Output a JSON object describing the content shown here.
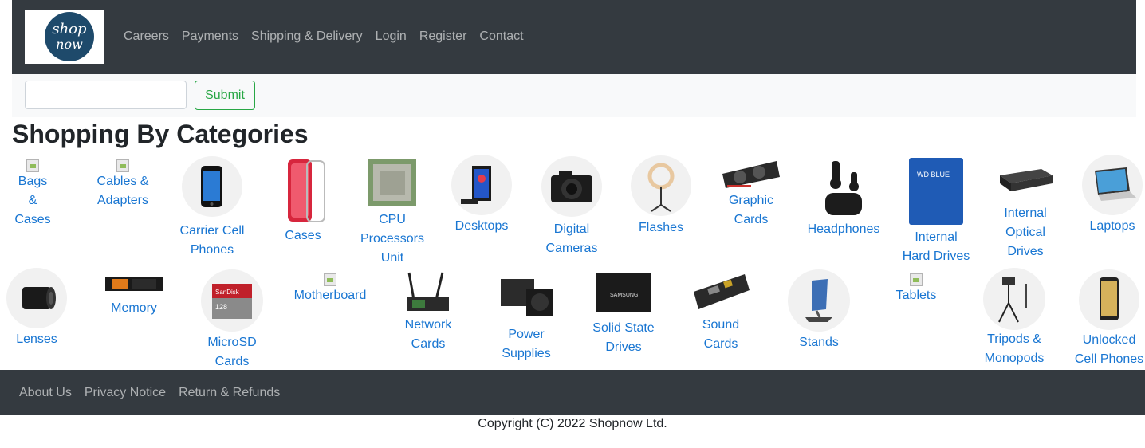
{
  "brand": {
    "logo_line1": "shop",
    "logo_line2": "now"
  },
  "nav": [
    "Careers",
    "Payments",
    "Shipping & Delivery",
    "Login",
    "Register",
    "Contact"
  ],
  "search": {
    "value": "",
    "placeholder": "",
    "submit_label": "Submit"
  },
  "heading": "Shopping By Categories",
  "categories": [
    {
      "l1": "Bags &",
      "l2": "Cases"
    },
    {
      "l1": "Cables &",
      "l2": "Adapters"
    },
    {
      "l1": "Carrier Cell",
      "l2": "Phones"
    },
    {
      "l1": "Cases"
    },
    {
      "l1": "CPU",
      "l2": "Processors",
      "l3": "Unit"
    },
    {
      "l1": "Desktops"
    },
    {
      "l1": "Digital",
      "l2": "Cameras"
    },
    {
      "l1": "Flashes"
    },
    {
      "l1": "Graphic",
      "l2": "Cards"
    },
    {
      "l1": "Headphones"
    },
    {
      "l1": "Internal",
      "l2": "Hard Drives"
    },
    {
      "l1": "Internal",
      "l2": "Optical",
      "l3": "Drives"
    },
    {
      "l1": "Laptops"
    },
    {
      "l1": "Lenses"
    },
    {
      "l1": "Memory"
    },
    {
      "l1": "MicroSD",
      "l2": "Cards"
    },
    {
      "l1": "Motherboard"
    },
    {
      "l1": "Network",
      "l2": "Cards"
    },
    {
      "l1": "Power",
      "l2": "Supplies"
    },
    {
      "l1": "Solid State",
      "l2": "Drives"
    },
    {
      "l1": "Sound Cards"
    },
    {
      "l1": "Stands"
    },
    {
      "l1": "Tablets"
    },
    {
      "l1": "Tripods &",
      "l2": "Monopods"
    },
    {
      "l1": "Unlocked",
      "l2": "Cell Phones"
    }
  ],
  "product_text": {
    "hdd_label": "WD BLUE",
    "ssd_brand": "SAMSUNG",
    "sd_brand": "SanDisk",
    "sd_size": "128"
  },
  "footer": [
    "About Us",
    "Privacy Notice",
    "Return & Refunds"
  ],
  "copyright": "Copyright (C) 2022 Shopnow Ltd.",
  "colors": {
    "navbar": "#343a40",
    "link": "#1976d2",
    "submit": "#28a745",
    "search_bg": "#f8f9fa"
  }
}
